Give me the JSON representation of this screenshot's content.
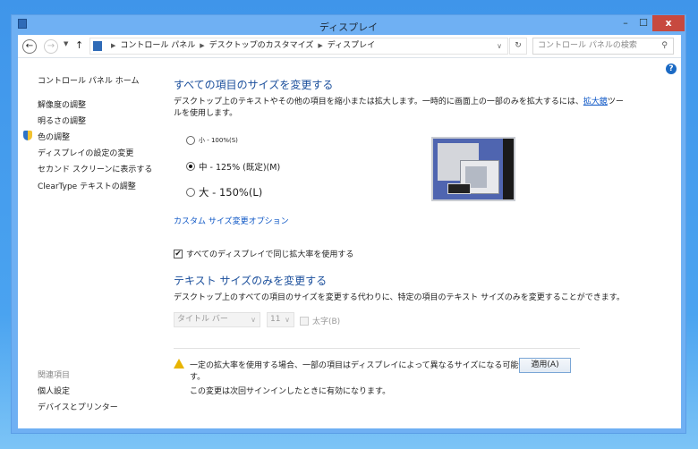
{
  "window": {
    "title": "ディスプレイ",
    "minimize": "–",
    "maximize": "☐",
    "close": "x"
  },
  "address": {
    "breadcrumb": [
      "コントロール パネル",
      "デスクトップのカスタマイズ",
      "ディスプレイ"
    ],
    "search_placeholder": "コントロール パネルの検索"
  },
  "sidebar": {
    "home": "コントロール パネル ホーム",
    "items": [
      "解像度の調整",
      "明るさの調整",
      "色の調整",
      "ディスプレイの設定の変更",
      "セカンド スクリーンに表示する",
      "ClearType テキストの調整"
    ],
    "related_heading": "関連項目",
    "related": [
      "個人設定",
      "デバイスとプリンター"
    ]
  },
  "main": {
    "heading1": "すべての項目のサイズを変更する",
    "desc1a": "デスクトップ上のテキストやその他の項目を縮小または拡大します。一時的に画面上の一部のみを拡大するには、",
    "desc1_link": "拡大鏡",
    "desc1b": "ツー",
    "desc1c": "ルを使用します。",
    "options": [
      {
        "label": "小 - 100%(S)",
        "selected": false
      },
      {
        "label": "中 - 125% (既定)(M)",
        "selected": true
      },
      {
        "label": "大 - 150%(L)",
        "selected": false
      }
    ],
    "custom_link": "カスタム サイズ変更オプション",
    "same_scale_label": "すべてのディスプレイで同じ拡大率を使用する",
    "same_scale_checked": true,
    "heading2": "テキスト サイズのみを変更する",
    "desc2": "デスクトップ上のすべての項目のサイズを変更する代わりに、特定の項目のテキスト サイズのみを変更することができます。",
    "item_select": "タイトル バー",
    "size_select": "11",
    "bold_label": "太字(B)",
    "bold_checked": false,
    "warning1": "一定の拡大率を使用する場合、一部の項目はディスプレイによって異なるサイズになる可能性がありま",
    "warning1b": "す。",
    "warning2": "この変更は次回サインインしたときに有効になります。",
    "apply": "適用(A)"
  }
}
